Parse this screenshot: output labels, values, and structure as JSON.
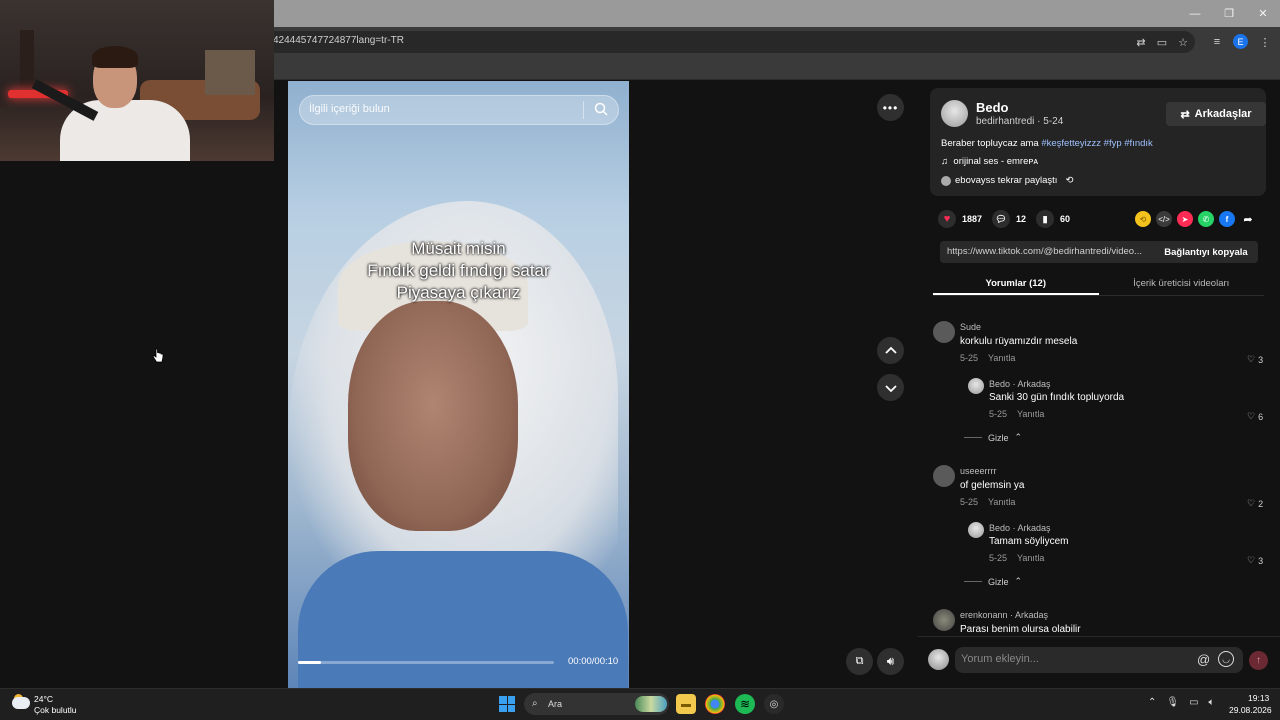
{
  "browser": {
    "url_visible": "424445747724877lang=tr-TR",
    "profile_initial": "E"
  },
  "video": {
    "search_placeholder": "İlgili içeriği bulun",
    "caption_lines": [
      "Müsait misin",
      "Fındık geldi fındıgı satar",
      "Piyasaya çıkarız"
    ],
    "timecode": "00:00/00:10",
    "progress": 0.09
  },
  "post": {
    "author_name": "Bedo",
    "author_sub": "bedirhantredi · 5-24",
    "friends_label": "Arkadaşlar",
    "desc_text": "Beraber topluycaz ama ",
    "tags": [
      "#keşfetteyizzz",
      "#fyp",
      "#fındık"
    ],
    "sound": "orijinal ses - emreᴘᴀ",
    "repost": "ebovayss tekrar paylaştı",
    "likes": "1887",
    "comments": "12",
    "saves": "60",
    "link": "https://www.tiktok.com/@bedirhantredi/video...",
    "copy_label": "Bağlantıyı kopyala"
  },
  "tabs": [
    "Yorumlar (12)",
    "İçerik üreticisi videoları"
  ],
  "comments": [
    {
      "name": "Sude",
      "text": "korkulu rüyamızdır mesela",
      "date": "5-25",
      "reply": "Yanıtla",
      "likes": "3",
      "sub": {
        "name": "Bedo · Arkadaş",
        "text": "Sanki 30 gün fındık topluyorda",
        "date": "5-25",
        "reply": "Yanıtla",
        "likes": "6"
      },
      "hide": "Gizle"
    },
    {
      "name": "useeerrrr",
      "text": "of gelemsin ya",
      "date": "5-25",
      "reply": "Yanıtla",
      "likes": "2",
      "sub": {
        "name": "Bedo · Arkadaş",
        "text": "Tamam söyliycem",
        "date": "5-25",
        "reply": "Yanıtla",
        "likes": "3"
      },
      "hide": "Gizle"
    },
    {
      "name": "erenkonann · Arkadaş",
      "text": "Parası benim olursa olabilir"
    }
  ],
  "comment_input_placeholder": "Yorum ekleyin...",
  "taskbar": {
    "temp": "24°C",
    "weather": "Çok bulutlu",
    "search": "Ara",
    "time": "19:13",
    "date": "29.08.2026"
  },
  "colors": {
    "accent_red": "#fe2c55",
    "tag_blue": "#9fc1ff",
    "panel_bg": "#121212"
  }
}
